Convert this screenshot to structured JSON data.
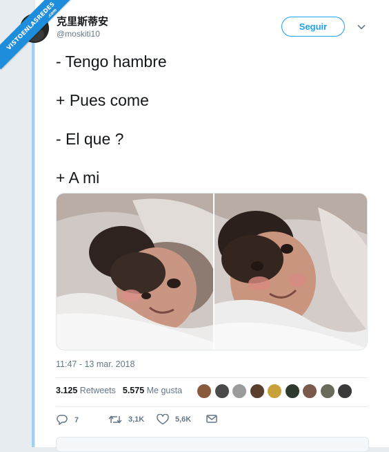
{
  "watermark": {
    "text": "VISTOENLASREDES",
    "sub": ".com"
  },
  "user": {
    "display_name": "克里斯蒂安",
    "handle": "@moskiti10"
  },
  "follow_label": "Seguir",
  "tweet_lines": [
    "- Tengo hambre",
    "+ Pues come",
    "- El que ?",
    "+ A mi"
  ],
  "timestamp": "11:47 - 13 mar. 2018",
  "stats": {
    "retweets_count": "3.125",
    "retweets_label": "Retweets",
    "likes_count": "5.575",
    "likes_label": "Me gusta"
  },
  "actions": {
    "replies": "7",
    "retweets": "3,1K",
    "likes": "5,6K"
  },
  "colors": {
    "accent": "#1da1f2",
    "watermark": "#1e8ddb",
    "thread_bar": "#9fd1f5"
  }
}
